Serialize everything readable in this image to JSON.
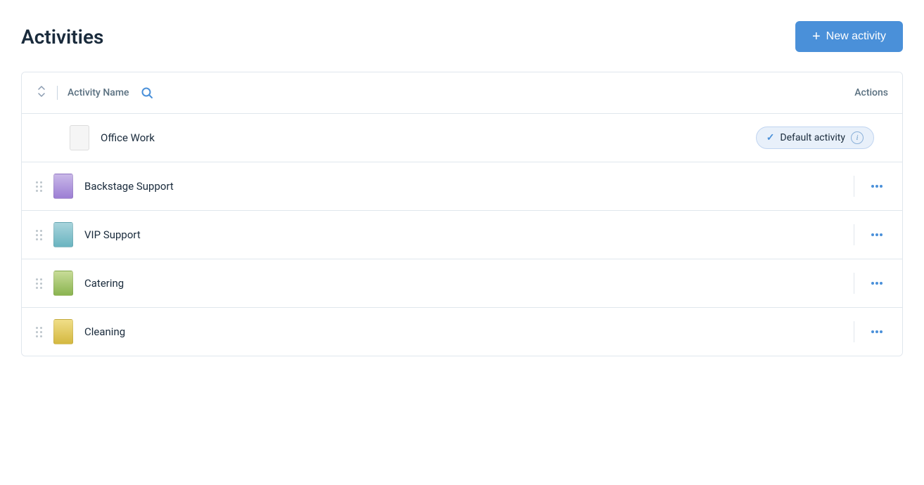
{
  "page": {
    "title": "Activities"
  },
  "header": {
    "new_activity_label": "New activity",
    "plus_symbol": "+"
  },
  "table": {
    "sort_col_label": "Activity Name",
    "actions_label": "Actions"
  },
  "activities": [
    {
      "id": "office-work",
      "name": "Office Work",
      "icon_class": "icon-white",
      "is_default": true,
      "default_label": "Default activity",
      "has_drag": false
    },
    {
      "id": "backstage-support",
      "name": "Backstage Support",
      "icon_class": "icon-purple",
      "is_default": false,
      "has_drag": true
    },
    {
      "id": "vip-support",
      "name": "VIP Support",
      "icon_class": "icon-teal",
      "is_default": false,
      "has_drag": true
    },
    {
      "id": "catering",
      "name": "Catering",
      "icon_class": "icon-green",
      "is_default": false,
      "has_drag": true
    },
    {
      "id": "cleaning",
      "name": "Cleaning",
      "icon_class": "icon-yellow",
      "is_default": false,
      "has_drag": true
    }
  ]
}
